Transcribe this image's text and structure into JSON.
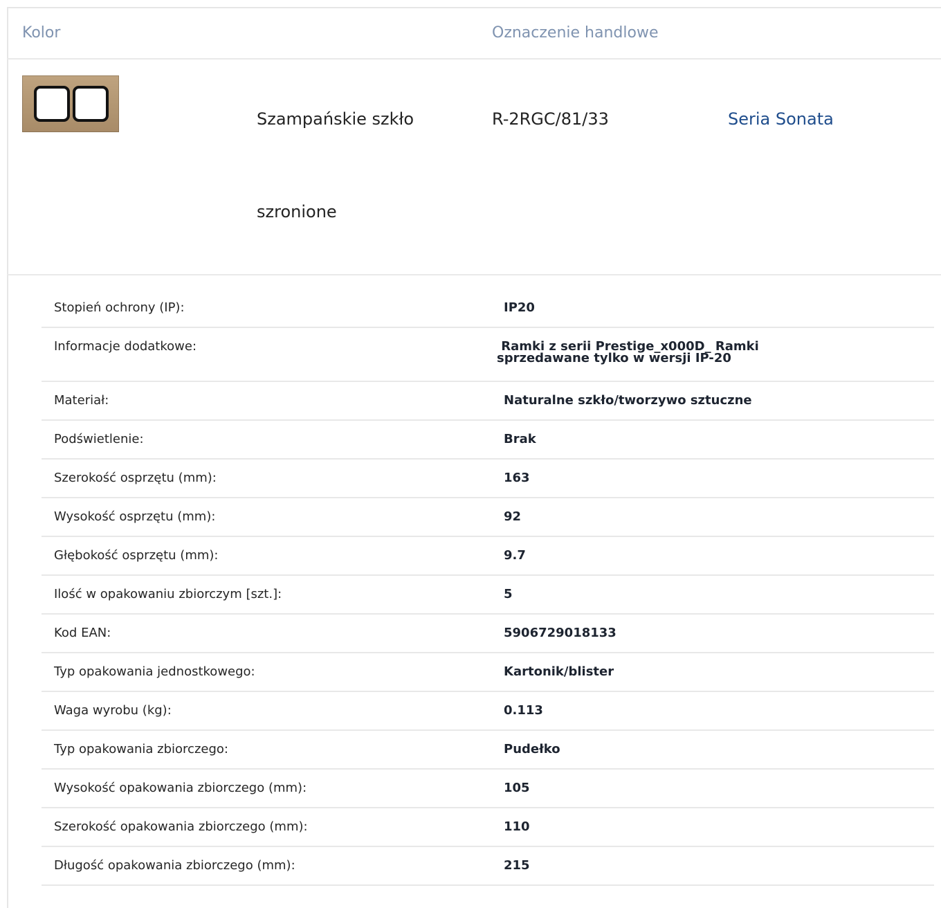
{
  "header": {
    "color_label": "Kolor",
    "trade_label": "Oznaczenie handlowe"
  },
  "product": {
    "swatch_icon": "double-frame-swatch-icon",
    "color_name_line1": "Szampańskie szkło",
    "color_name_line2": "szronione",
    "code": "R-2RGC/81/33",
    "series_link": "Seria Sonata",
    "colors": {
      "swatch": "#b29672",
      "link": "#1f4d8c",
      "header": "#7f93b0"
    }
  },
  "specs": [
    {
      "key": "Stopień ochrony (IP):",
      "value": "IP20"
    },
    {
      "key": "Informacje dodatkowe:",
      "value_line1": " Ramki z serii Prestige_x000D_ Ramki",
      "value_line2": "sprzedawane tylko w wersji IP-20"
    },
    {
      "key": "Materiał:",
      "value": "Naturalne szkło/tworzywo sztuczne"
    },
    {
      "key": "Podświetlenie:",
      "value": "Brak"
    },
    {
      "key": "Szerokość osprzętu (mm):",
      "value": "163"
    },
    {
      "key": "Wysokość osprzętu (mm):",
      "value": "92"
    },
    {
      "key": "Głębokość osprzętu (mm):",
      "value": "9.7"
    },
    {
      "key": "Ilość w opakowaniu zbiorczym [szt.]:",
      "value": "5"
    },
    {
      "key": "Kod EAN:",
      "value": "5906729018133"
    },
    {
      "key": "Typ opakowania jednostkowego:",
      "value": "Kartonik/blister"
    },
    {
      "key": "Waga wyrobu (kg):",
      "value": "0.113"
    },
    {
      "key": "Typ opakowania zbiorczego:",
      "value": "Pudełko"
    },
    {
      "key": "Wysokość opakowania zbiorczego (mm):",
      "value": "105"
    },
    {
      "key": "Szerokość opakowania zbiorczego (mm):",
      "value": "110"
    },
    {
      "key": "Długość opakowania zbiorczego (mm):",
      "value": "215"
    }
  ]
}
